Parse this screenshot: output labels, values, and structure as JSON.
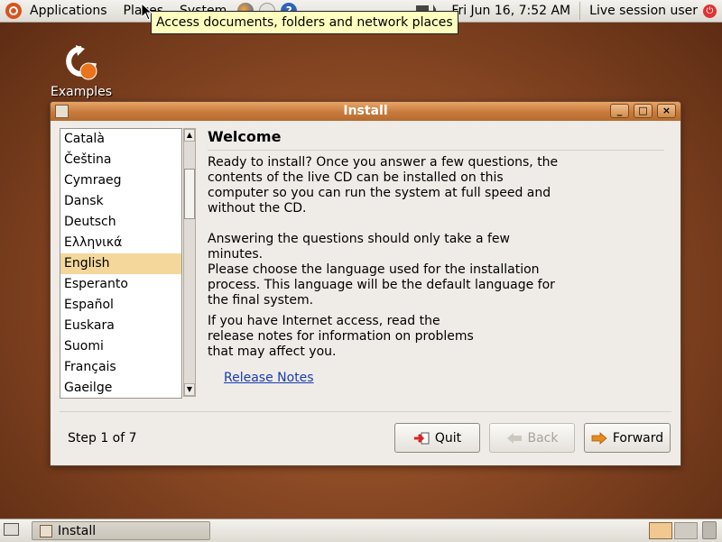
{
  "top_panel": {
    "menus": [
      "Applications",
      "Places",
      "System"
    ],
    "datetime": "Fri Jun 16,  7:52 AM",
    "session_user": "Live session user"
  },
  "tooltip": "Access documents, folders and network places",
  "desktop": {
    "icon_label": "Examples"
  },
  "window": {
    "title": "Install",
    "languages": [
      "Català",
      "Čeština",
      "Cymraeg",
      "Dansk",
      "Deutsch",
      "Ελληνικά",
      "English",
      "Esperanto",
      "Español",
      "Euskara",
      "Suomi",
      "Français",
      "Gaeilge"
    ],
    "selected_language": "English",
    "heading": "Welcome",
    "paragraphs": [
      "Ready to install? Once you answer a few questions, the contents of the live CD can be installed on this computer so you can run the system at full speed and without the CD.",
      "Answering the questions should only take a few minutes.",
      "Please choose the language used for the installation process. This language will be the default language for the final system.",
      "If you have Internet access, read the release notes for information on problems that may affect you."
    ],
    "release_notes_link": "Release Notes",
    "step_label": "Step 1 of 7",
    "buttons": {
      "quit": "Quit",
      "back": "Back",
      "forward": "Forward"
    }
  },
  "bottom_panel": {
    "task_label": "Install"
  },
  "colors": {
    "accent": "#d9531e",
    "selection": "#f3d79b",
    "link": "#1a3bb0"
  }
}
